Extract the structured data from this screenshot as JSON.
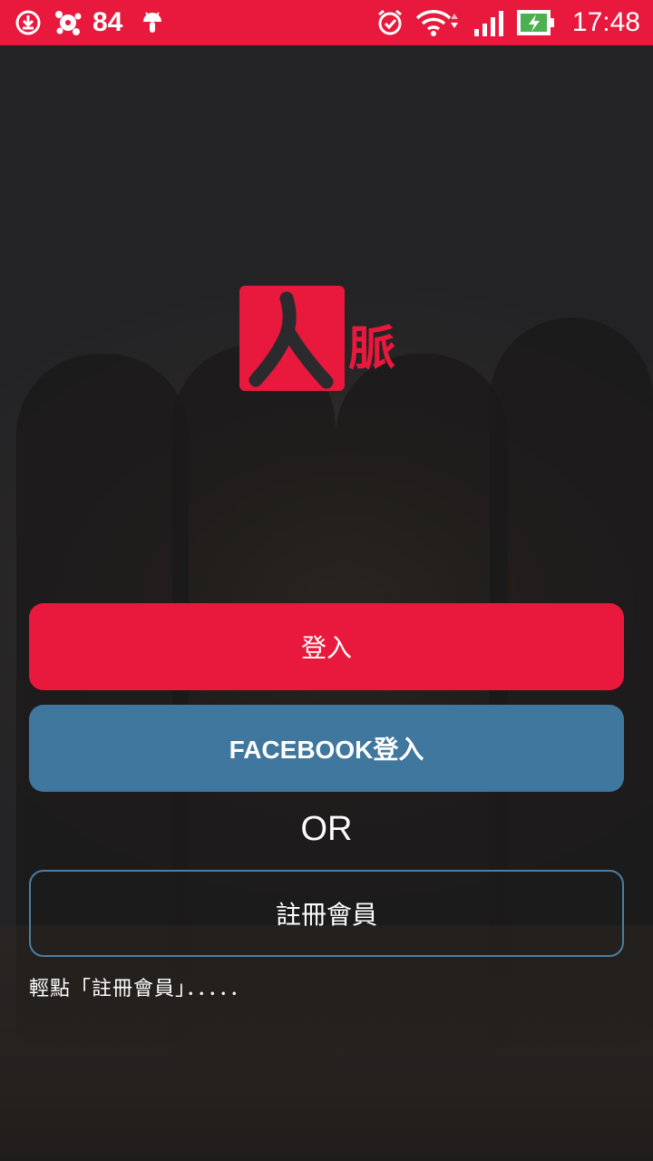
{
  "status_bar": {
    "notification_count": "84",
    "time": "17:48",
    "icons": [
      "download-icon",
      "avast-icon",
      "android-icon",
      "alarm-icon",
      "wifi-icon",
      "signal-icon",
      "battery-charging-icon"
    ]
  },
  "logo": {
    "text": "脈"
  },
  "buttons": {
    "login": "登入",
    "facebook_login": "FACEBOOK登入",
    "or": "OR",
    "register": "註冊會員"
  },
  "hint": "輕點「註冊會員」．．．．．",
  "colors": {
    "accent": "#e8193c",
    "facebook": "#40779e",
    "register_border": "#4b7ea3"
  }
}
